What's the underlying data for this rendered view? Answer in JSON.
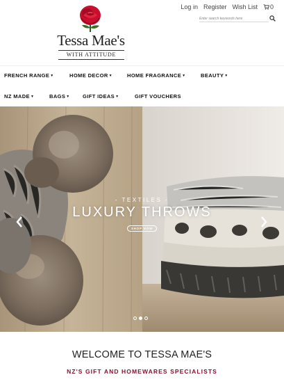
{
  "brand": {
    "name": "Tessa Mae's",
    "tagline": "WITH ATTITUDE",
    "rose_color": "#c8102e"
  },
  "top_links": {
    "login": "Log in",
    "register": "Register",
    "wishlist": "Wish List",
    "cart_count": "0"
  },
  "search": {
    "placeholder": "Enter search keywords here"
  },
  "nav": {
    "row1": [
      {
        "label": "FRENCH RANGE",
        "dropdown": true
      },
      {
        "label": "HOME DECOR",
        "dropdown": true
      },
      {
        "label": "HOME FRAGRANCE",
        "dropdown": true
      },
      {
        "label": "BEAUTY",
        "dropdown": true
      }
    ],
    "row2": [
      {
        "label": "NZ MADE",
        "dropdown": true
      },
      {
        "label": "BAGS",
        "dropdown": true
      },
      {
        "label": "GIFT IDEAS",
        "dropdown": true
      },
      {
        "label": "GIFT VOUCHERS",
        "dropdown": false
      }
    ]
  },
  "hero": {
    "kicker": "- TEXTILES -",
    "title": "LUXURY THROWS",
    "button": "SHOP NOW",
    "slides_total": 3,
    "active_slide": 2
  },
  "welcome": {
    "title": "WELCOME TO TESSA MAE'S",
    "subtitle": "NZ'S GIFT AND HOMEWARES SPECIALISTS",
    "accent_color": "#8a1030"
  }
}
